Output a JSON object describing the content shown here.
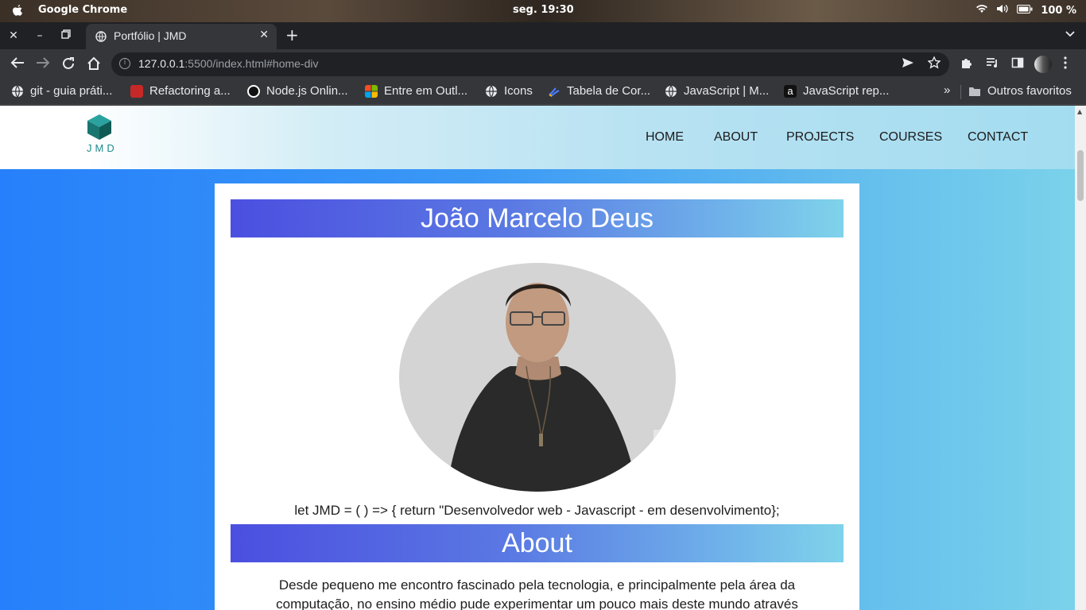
{
  "os": {
    "app_name": "Google Chrome",
    "clock": "seg. 19:30",
    "battery": "100 %"
  },
  "browser": {
    "tab_title": "Portfólio | JMD",
    "url_host": "127.0.0.1",
    "url_rest": ":5500/index.html#home-div",
    "bookmarks": [
      {
        "label": "git - guia práti...",
        "icon": "globe-icon"
      },
      {
        "label": "Refactoring a...",
        "icon": "refactoring-icon"
      },
      {
        "label": "Node.js Onlin...",
        "icon": "nodejs-icon"
      },
      {
        "label": "Entre em Outl...",
        "icon": "microsoft-icon"
      },
      {
        "label": "Icons",
        "icon": "globe-icon"
      },
      {
        "label": "Tabela de Cor...",
        "icon": "color-table-icon"
      },
      {
        "label": "JavaScript | M...",
        "icon": "globe-icon"
      },
      {
        "label": "JavaScript rep...",
        "icon": "amazon-icon"
      }
    ],
    "other_bookmarks": "Outros favoritos"
  },
  "site": {
    "logo_text": "JMD",
    "nav": [
      "HOME",
      "ABOUT",
      "PROJECTS",
      "COURSES",
      "CONTACT"
    ],
    "name_heading": "João Marcelo Deus",
    "tagline": "let JMD = ( ) => { return \"Desenvolvedor web - Javascript - em desenvolvimento};",
    "about_heading": "About",
    "about_text": "Desde pequeno me encontro fascinado pela tecnologia, e principalmente pela área da computação, no ensino médio pude experimentar um pouco mais deste mundo através"
  },
  "colors": {
    "page_gradient_start": "#2680fb",
    "page_gradient_end": "#7ad2ea",
    "banner_start": "#4b4fe0",
    "banner_end": "#7fd3ea",
    "logo_teal": "#1f8a8a"
  }
}
